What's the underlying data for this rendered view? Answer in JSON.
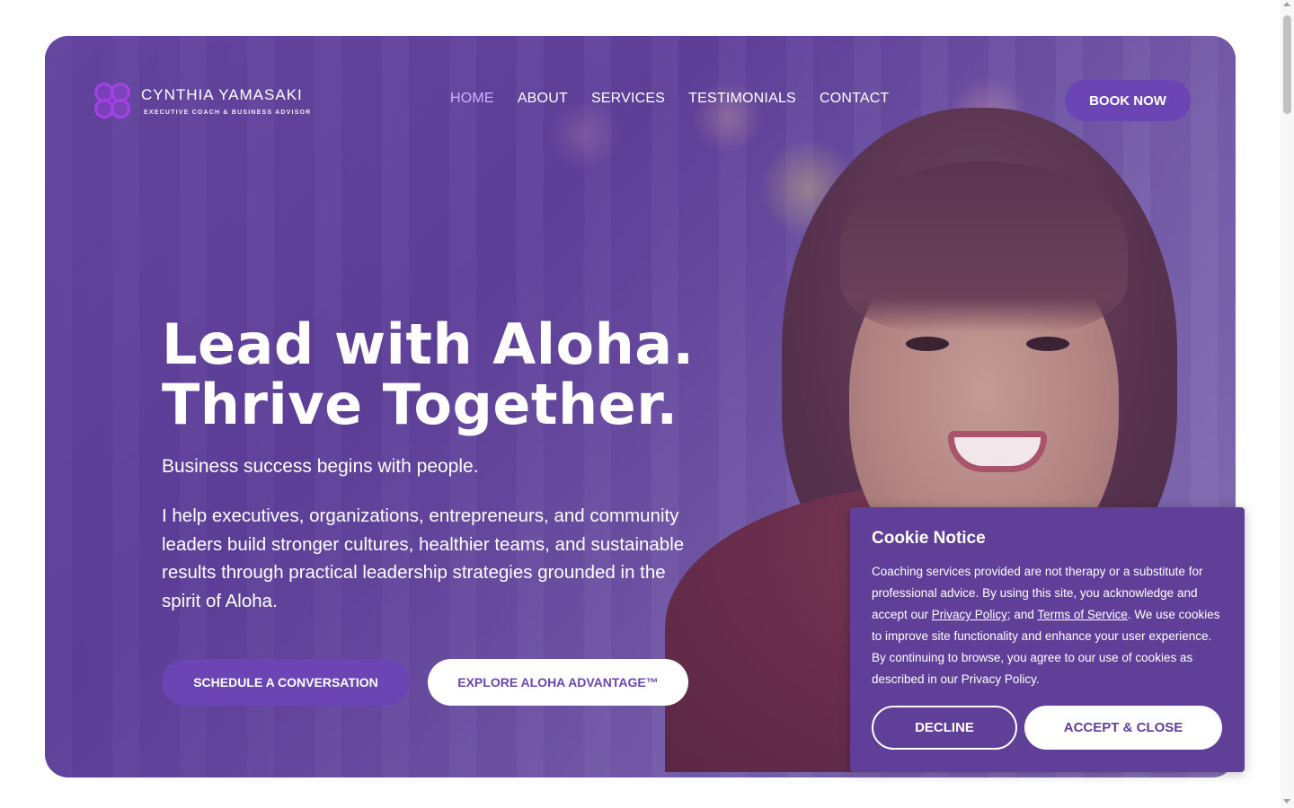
{
  "header": {
    "logo_name": "CYNTHIA YAMASAKI",
    "logo_sub": "EXECUTIVE COACH & BUSINESS ADVISOR",
    "nav": [
      {
        "label": "HOME",
        "active": true
      },
      {
        "label": "ABOUT"
      },
      {
        "label": "SERVICES"
      },
      {
        "label": "TESTIMONIALS"
      },
      {
        "label": "CONTACT"
      }
    ],
    "book_label": "BOOK NOW"
  },
  "hero": {
    "headline_line1": "Lead with Aloha.",
    "headline_line2": "Thrive Together.",
    "tagline": "Business success begins with people.",
    "body": "I help executives, organizations, entrepreneurs, and community leaders build stronger cultures, healthier teams, and sustainable results through practical leadership strategies grounded in the spirit of Aloha.",
    "primary_cta": "SCHEDULE A CONVERSATION",
    "secondary_cta": "EXPLORE ALOHA ADVANTAGE™"
  },
  "cookie": {
    "title": "Cookie Notice",
    "text_before": "Coaching services provided are not therapy or a substitute for professional advice. By using this site, you acknowledge and accept our ",
    "privacy_link": "Privacy Policy",
    "separator": "; and ",
    "terms_link": "Terms of Service",
    "text_after": ". We use cookies to improve site functionality and enhance your user experience. By continuing to browse, you agree to our use of cookies as described in our Privacy Policy.",
    "decline_label": "DECLINE",
    "accept_label": "ACCEPT & CLOSE"
  },
  "colors": {
    "brand_purple": "#6a45b3",
    "cookie_bg": "#5f3f98",
    "active_nav": "#cdb4ff"
  }
}
